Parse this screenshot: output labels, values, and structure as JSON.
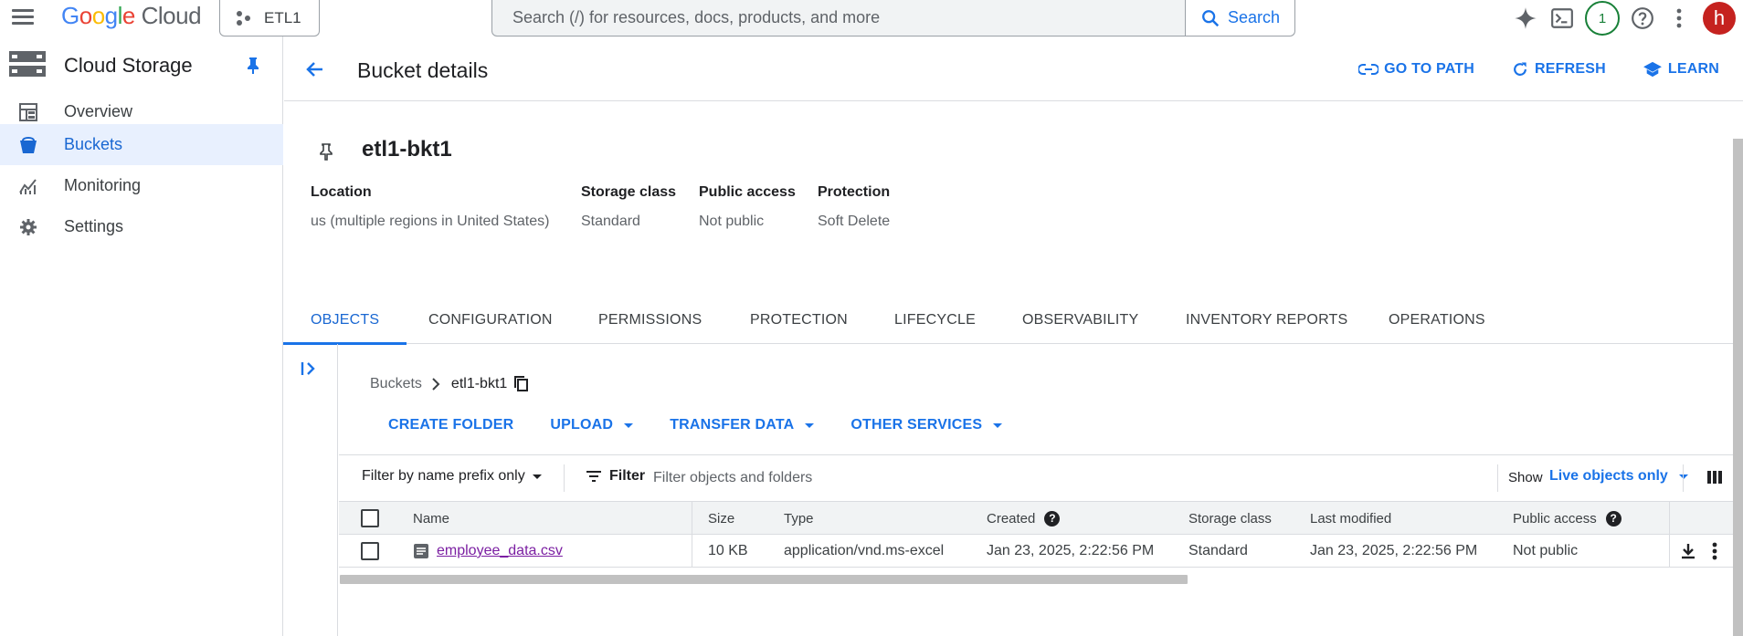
{
  "topbar": {
    "logo_google": [
      "G",
      "o",
      "o",
      "g",
      "l",
      "e"
    ],
    "logo_cloud": "Cloud",
    "project": "ETL1",
    "search_placeholder": "Search (/) for resources, docs, products, and more",
    "search_label": "Search",
    "notification_count": "1",
    "avatar_letter": "h"
  },
  "sidebar": {
    "title": "Cloud Storage",
    "items": [
      {
        "label": "Overview",
        "icon": "dashboard-icon"
      },
      {
        "label": "Buckets",
        "icon": "bucket-icon",
        "active": true
      },
      {
        "label": "Monitoring",
        "icon": "monitoring-icon"
      },
      {
        "label": "Settings",
        "icon": "gear-icon"
      }
    ]
  },
  "header": {
    "title": "Bucket details",
    "actions": [
      "GO TO PATH",
      "REFRESH",
      "LEARN"
    ]
  },
  "bucket": {
    "name": "etl1-bkt1",
    "meta": [
      {
        "key": "Location",
        "value": "us (multiple regions in United States)"
      },
      {
        "key": "Storage class",
        "value": "Standard"
      },
      {
        "key": "Public access",
        "value": "Not public"
      },
      {
        "key": "Protection",
        "value": "Soft Delete"
      }
    ]
  },
  "tabs": [
    "OBJECTS",
    "CONFIGURATION",
    "PERMISSIONS",
    "PROTECTION",
    "LIFECYCLE",
    "OBSERVABILITY",
    "INVENTORY REPORTS",
    "OPERATIONS"
  ],
  "active_tab": "OBJECTS",
  "breadcrumb": {
    "root": "Buckets",
    "current": "etl1-bkt1"
  },
  "actionbar": {
    "create_folder": "CREATE FOLDER",
    "upload": "UPLOAD",
    "transfer": "TRANSFER DATA",
    "other": "OTHER SERVICES"
  },
  "filterbar": {
    "mode": "Filter by name prefix only",
    "filter_label": "Filter",
    "placeholder": "Filter objects and folders",
    "show_label": "Show",
    "show_value": "Live objects only"
  },
  "table": {
    "columns": [
      "Name",
      "Size",
      "Type",
      "Created",
      "Storage class",
      "Last modified",
      "Public access"
    ],
    "rows": [
      {
        "name": "employee_data.csv",
        "size": "10 KB",
        "type": "application/vnd.ms-excel",
        "created": "Jan 23, 2025, 2:22:56 PM",
        "storage_class": "Standard",
        "last_modified": "Jan 23, 2025, 2:22:56 PM",
        "public_access": "Not public"
      }
    ]
  },
  "colors": {
    "accent": "#1a73e8",
    "active_bg": "#e8f0fe",
    "link_visited": "#7b1fa2"
  }
}
